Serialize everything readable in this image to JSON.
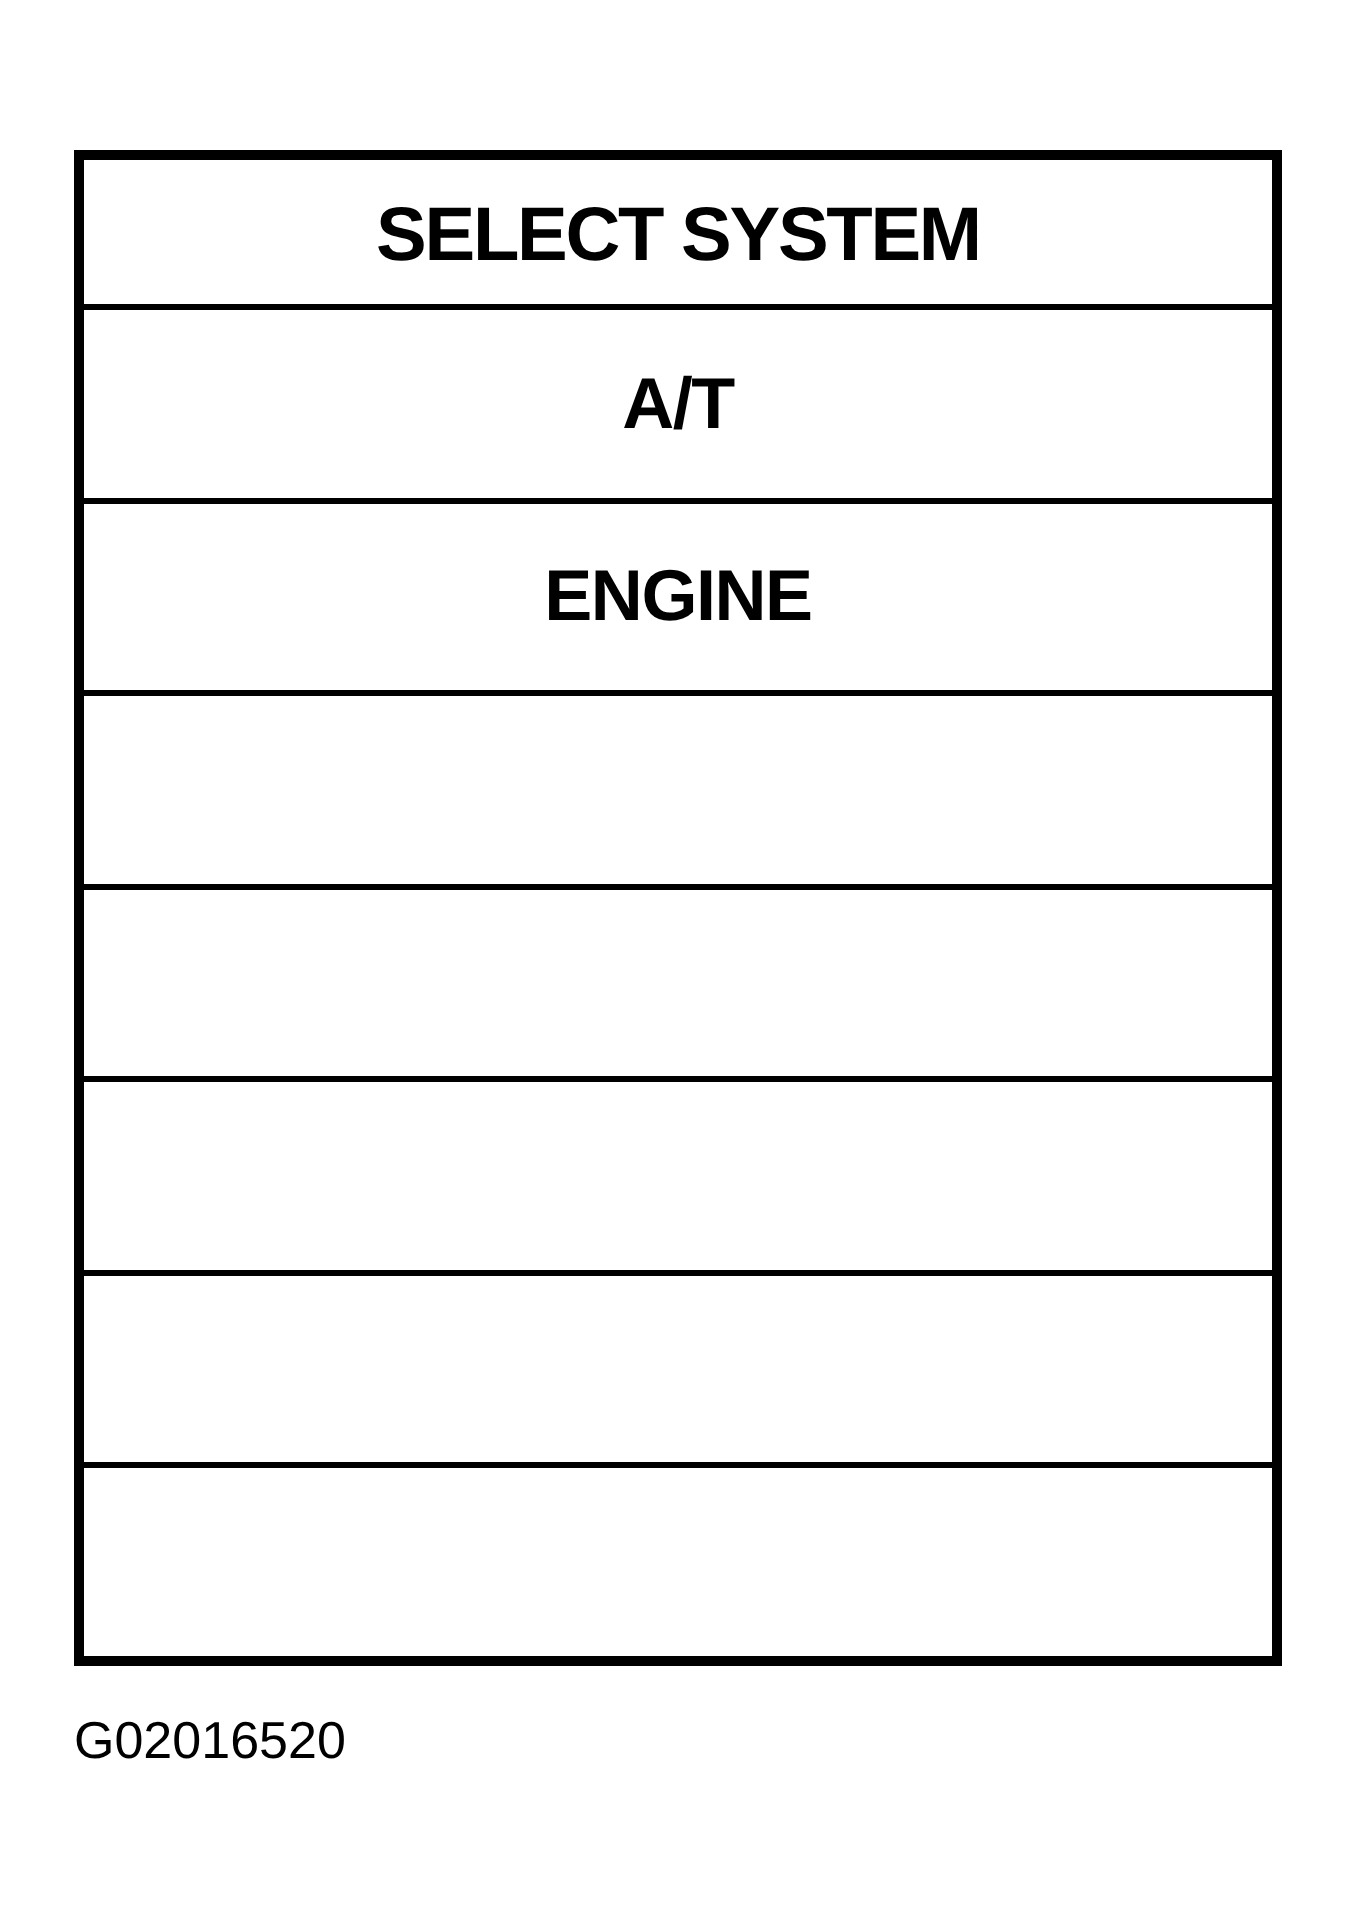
{
  "screen": {
    "title": "SELECT SYSTEM",
    "rows": [
      {
        "kind": "option",
        "label": "A/T"
      },
      {
        "kind": "option",
        "label": "ENGINE"
      },
      {
        "kind": "empty"
      },
      {
        "kind": "empty"
      },
      {
        "kind": "empty"
      },
      {
        "kind": "empty"
      },
      {
        "kind": "empty"
      }
    ]
  },
  "figure_code": "G02016520"
}
